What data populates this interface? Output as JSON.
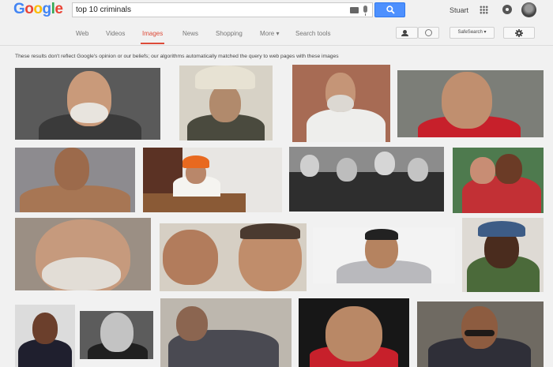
{
  "logo": [
    "G",
    "o",
    "o",
    "g",
    "l",
    "e"
  ],
  "logo_colors": [
    "#4285f4",
    "#ea4335",
    "#fbbc05",
    "#4285f4",
    "#34a853",
    "#ea4335"
  ],
  "search": {
    "query": "top 10 criminals"
  },
  "header": {
    "user_name": "Stuart"
  },
  "nav": {
    "tabs": [
      "Web",
      "Videos",
      "Images",
      "News",
      "Shopping",
      "More ▾",
      "Search tools"
    ],
    "active_tab": "Images",
    "safesearch_label": "SafeSearch ▾"
  },
  "disclaimer": "These results don't reflect Google's opinion or our beliefs; our algorithms automatically matched the query to web pages with these images",
  "colors": {
    "accent_red": "#dd4b39",
    "search_blue": "#4d90fe",
    "background": "#f1f1f1"
  }
}
